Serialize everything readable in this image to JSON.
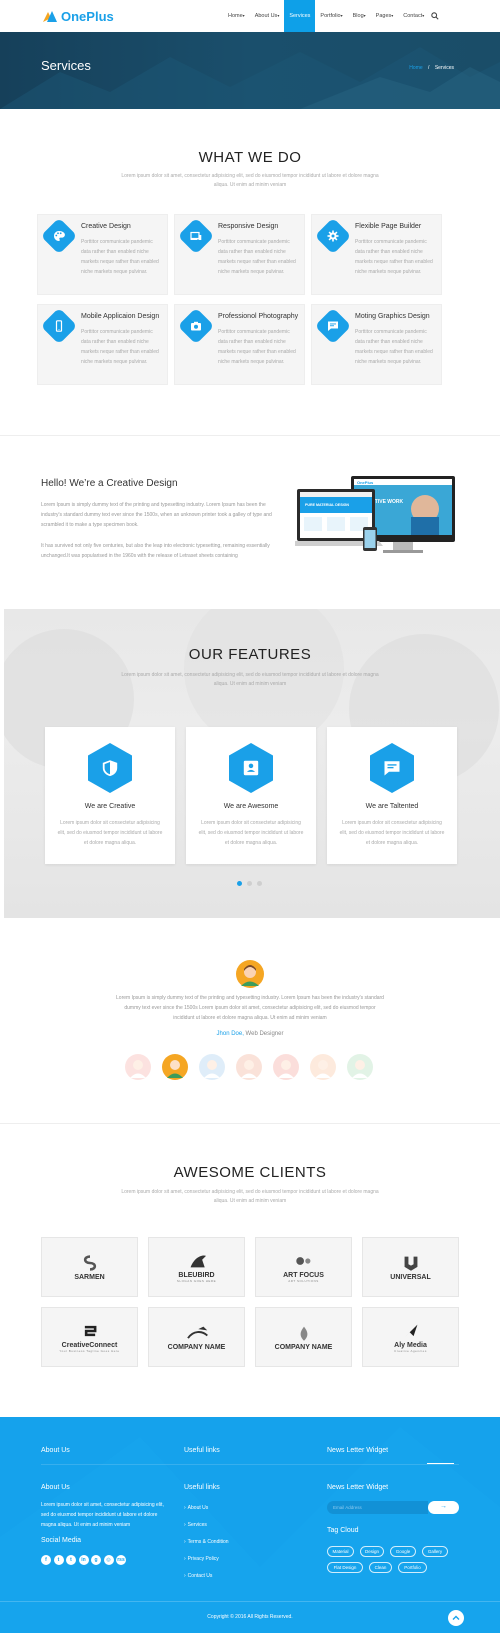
{
  "brand": {
    "name": "OnePlus"
  },
  "nav": {
    "items": [
      {
        "label": "Home",
        "caret": "▾"
      },
      {
        "label": "About Us",
        "caret": "▾"
      },
      {
        "label": "Services",
        "caret": ""
      },
      {
        "label": "Portfolio",
        "caret": "▾"
      },
      {
        "label": "Blog",
        "caret": "▾"
      },
      {
        "label": "Pages",
        "caret": "▾"
      },
      {
        "label": "Contact",
        "caret": "▾"
      }
    ],
    "active": "Services"
  },
  "banner": {
    "title": "Services",
    "breadcrumb_home": "Home",
    "breadcrumb_sep": "/",
    "breadcrumb_current": "Services"
  },
  "what_we_do": {
    "title": "WHAT WE DO",
    "subtitle": "Lorem ipsum dolor sit amet, consectetur adipisicing elit, sed do eiusmod tempor incididunt ut labore et dolore magna aliqua. Ut enim ad minim veniam",
    "services": [
      {
        "title": "Creative Design",
        "icon": "palette-icon",
        "text": "Porttitor communicate pandemic data rather than enabled niche markets neque rather than enabled niche markets neque pulvinar."
      },
      {
        "title": "Responsive Design",
        "icon": "devices-icon",
        "text": "Porttitor communicate pandemic data rather than enabled niche markets neque rather than enabled niche markets neque pulvinar."
      },
      {
        "title": "Flexible Page Builder",
        "icon": "gear-icon",
        "text": "Porttitor communicate pandemic data rather than enabled niche markets neque rather than enabled niche markets neque pulvinar."
      },
      {
        "title": "Mobile Applicaion Design",
        "icon": "smartphone-icon",
        "text": "Porttitor communicate pandemic data rather than enabled niche markets neque rather than enabled niche markets neque pulvinar."
      },
      {
        "title": "Professionol Photography",
        "icon": "camera-icon",
        "text": "Porttitor communicate pandemic data rather than enabled niche markets neque rather than enabled niche markets neque pulvinar."
      },
      {
        "title": "Moting Graphics Design",
        "icon": "chat-icon",
        "text": "Porttitor communicate pandemic data rather than enabled niche markets neque rather than enabled niche markets neque pulvinar."
      }
    ]
  },
  "creative": {
    "title": "Hello! We’re a Creative Design",
    "p1": "Lorem Ipsum is simply dummy text of the printing and typesetting industry. Lorem Ipsum has been the industry's standard dummy text ever since the 1500s, when an unknown printer took a galley of type and scrambled it to make a type specimen book.",
    "p2": "It has survived not only five centuries, but also the leap into electronic typesetting, remaining essentially unchanged.It was popularised in the 1960s with the release of Letraset sheets containing",
    "mockup_logo": "OnePlus",
    "mockup_creative": "CREATIVE WORK",
    "mockup_material": "PURE MATERIAL DESIGN"
  },
  "features": {
    "title": "OUR FEATURES",
    "subtitle": "Lorem ipsum dolor sit amet, consectetur adipisicing elit, sed do eiusmod tempor incididunt ut labore et dolore magna aliqua. Ut enim ad minim veniam",
    "items": [
      {
        "title": "We are Creative",
        "icon": "shield-icon",
        "text": "Lorem ipsum dolor sit consectetur adipisicing elit, sed do eiusmod tempor incididunt ut labore et dolore magna aliqua."
      },
      {
        "title": "We are Awesome",
        "icon": "id-card-icon",
        "text": "Lorem ipsum dolor sit consectetur adipisicing elit, sed do eiusmod tempor incididunt ut labore et dolore magna aliqua."
      },
      {
        "title": "We are Taltented",
        "icon": "chat-icon",
        "text": "Lorem ipsum dolor sit consectetur adipisicing elit, sed do eiusmod tempor incididunt ut labore et dolore magna aliqua."
      }
    ],
    "slider": {
      "total": 3,
      "active": 1
    }
  },
  "testimonial": {
    "text": "Lorem Ipsum is simply dummy text of the printing and typesetting industry. Lorem Ipsum has been the industry's standard dummy text ever since the 1500s Lorem ipsum dolor sit amet, consectetur adipisicing elit, sed do eiusmod tempor incididunt ut labore et dolore magna aliqua. Ut enim ad minim veniam",
    "name": "Jhon Doe,",
    "role": " Web Designer"
  },
  "clients": {
    "title": "AWESOME CLIENTS",
    "subtitle": "Lorem ipsum dolor sit amet, consectetur adipisicing elit, sed do eiusmod tempor incididunt ut labore et dolore magna aliqua. Ut enim ad minim veniam",
    "logos": [
      {
        "name": "SARMEN",
        "tag": ""
      },
      {
        "name": "BLEUBIRD",
        "tag": "SLOGAN GOES HERE"
      },
      {
        "name": "ART FOCUS",
        "tag": "ART SOLUTIONS"
      },
      {
        "name": "UNIVERSAL",
        "tag": ""
      },
      {
        "name": "CreativeConnect",
        "tag": "Your Business Tagline Goes Here"
      },
      {
        "name": "COMPANY NAME",
        "tag": ""
      },
      {
        "name": "COMPANY NAME",
        "tag": ""
      },
      {
        "name": "Aly Media",
        "tag": "Creative Agencies"
      }
    ]
  },
  "footer": {
    "col1_heading_top": "About Us",
    "col2_heading_top": "Useful links",
    "col3_heading_top": "News Letter Widget",
    "about_heading": "About Us",
    "about_text": "Lorem ipsum dolor sit amet, consectetur adipisicing elit, sed do eiusmod tempor incididunt ut labore et dolore magna aliqua. Ut enim ad minim veniam",
    "social_heading": "Social Media",
    "social": [
      "f",
      "t",
      "t",
      "in",
      "g",
      "◎",
      "rss"
    ],
    "links_heading": "Useful links",
    "links": [
      "About Us",
      "Services",
      "Terms & Condition",
      "Privacy Policy",
      "Contact Us"
    ],
    "link_prefix": "›",
    "newsletter_heading": "News Letter Widget",
    "email_placeholder": "Email Address",
    "submit_arrow": "→",
    "tag_heading": "Tag Cloud",
    "tags": [
      "Material",
      "Design",
      "Google",
      "Gallery",
      "Flat Design",
      "Clean",
      "Portfolio"
    ],
    "copyright": "Copyright © 2016 All Rights Reserved."
  }
}
